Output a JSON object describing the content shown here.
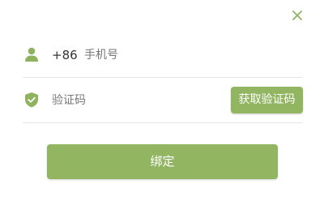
{
  "colors": {
    "accent": "#92b562",
    "icon": "#8fb25e",
    "divider": "#e6e6e6",
    "text": "#333333",
    "placeholder": "#777777"
  },
  "dialog": {
    "close_icon": "close-icon"
  },
  "phone": {
    "icon": "user-icon",
    "country_code": "+86",
    "value": "",
    "placeholder": "手机号"
  },
  "verification": {
    "icon": "shield-check-icon",
    "value": "",
    "placeholder": "验证码",
    "get_code_label": "获取验证码"
  },
  "submit": {
    "label": "绑定"
  }
}
